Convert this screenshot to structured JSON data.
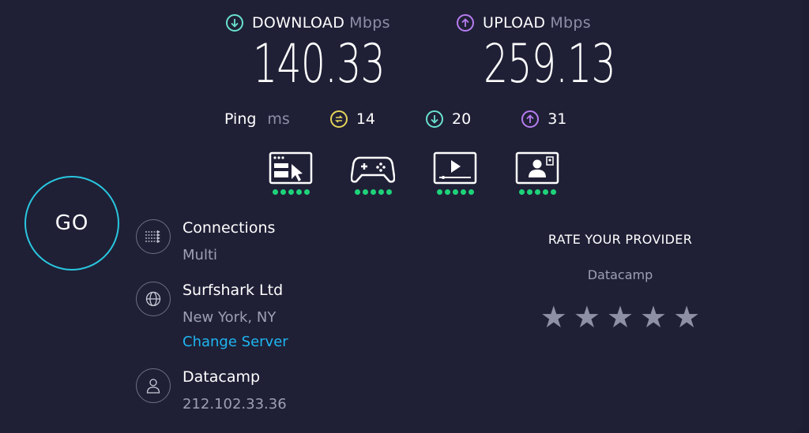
{
  "download": {
    "label": "DOWNLOAD",
    "unit": "Mbps",
    "value": "140.33",
    "color": "#69e2cf"
  },
  "upload": {
    "label": "UPLOAD",
    "unit": "Mbps",
    "value": "259.13",
    "color": "#b77cf0"
  },
  "ping": {
    "label": "Ping",
    "unit": "ms",
    "idle": "14",
    "download": "20",
    "upload": "31",
    "idle_color": "#e5d45a"
  },
  "activities": [
    {
      "icon": "web-browsing-icon",
      "rating": 5
    },
    {
      "icon": "gaming-controller-icon",
      "rating": 5
    },
    {
      "icon": "video-streaming-icon",
      "rating": 5
    },
    {
      "icon": "video-call-icon",
      "rating": 5
    }
  ],
  "go_label": "GO",
  "connections": {
    "label": "Connections",
    "value": "Multi"
  },
  "server": {
    "name": "Surfshark Ltd",
    "location": "New York, NY",
    "change_label": "Change Server"
  },
  "isp": {
    "name": "Datacamp",
    "ip": "212.102.33.36"
  },
  "rate": {
    "title": "RATE YOUR PROVIDER",
    "provider": "Datacamp",
    "stars": 5
  }
}
